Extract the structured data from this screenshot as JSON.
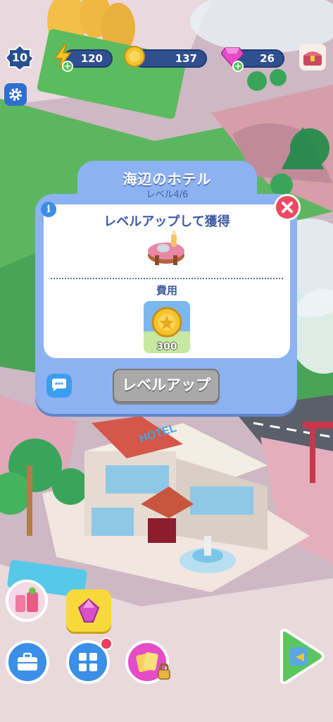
{
  "hud": {
    "level": "10",
    "energy": "120",
    "coins": "137",
    "gems": "26"
  },
  "panel": {
    "title": "海辺のホテル",
    "subtitle": "レベル4/6",
    "gain_title": "レベルアップして獲得",
    "cost_label": "費用",
    "cost_value": "300",
    "level_up_label": "レベルアップ"
  },
  "building_sign": "HOTEL",
  "icons": [
    "level-badge-icon",
    "energy-icon",
    "coin-icon",
    "gem-icon",
    "chest-icon",
    "gear-icon",
    "info-icon",
    "close-icon",
    "chat-icon",
    "table-reward-icon",
    "coin-cost-icon",
    "drinks-icon",
    "gem-bubble-icon",
    "briefcase-icon",
    "grid-icon",
    "cards-icon",
    "lock-icon",
    "next-icon"
  ],
  "colors": {
    "panel": "#8cb2f2",
    "close": "#ec4a63",
    "button_disabled": "#a9a9a9",
    "hud_pill": "#2f4f8f"
  }
}
